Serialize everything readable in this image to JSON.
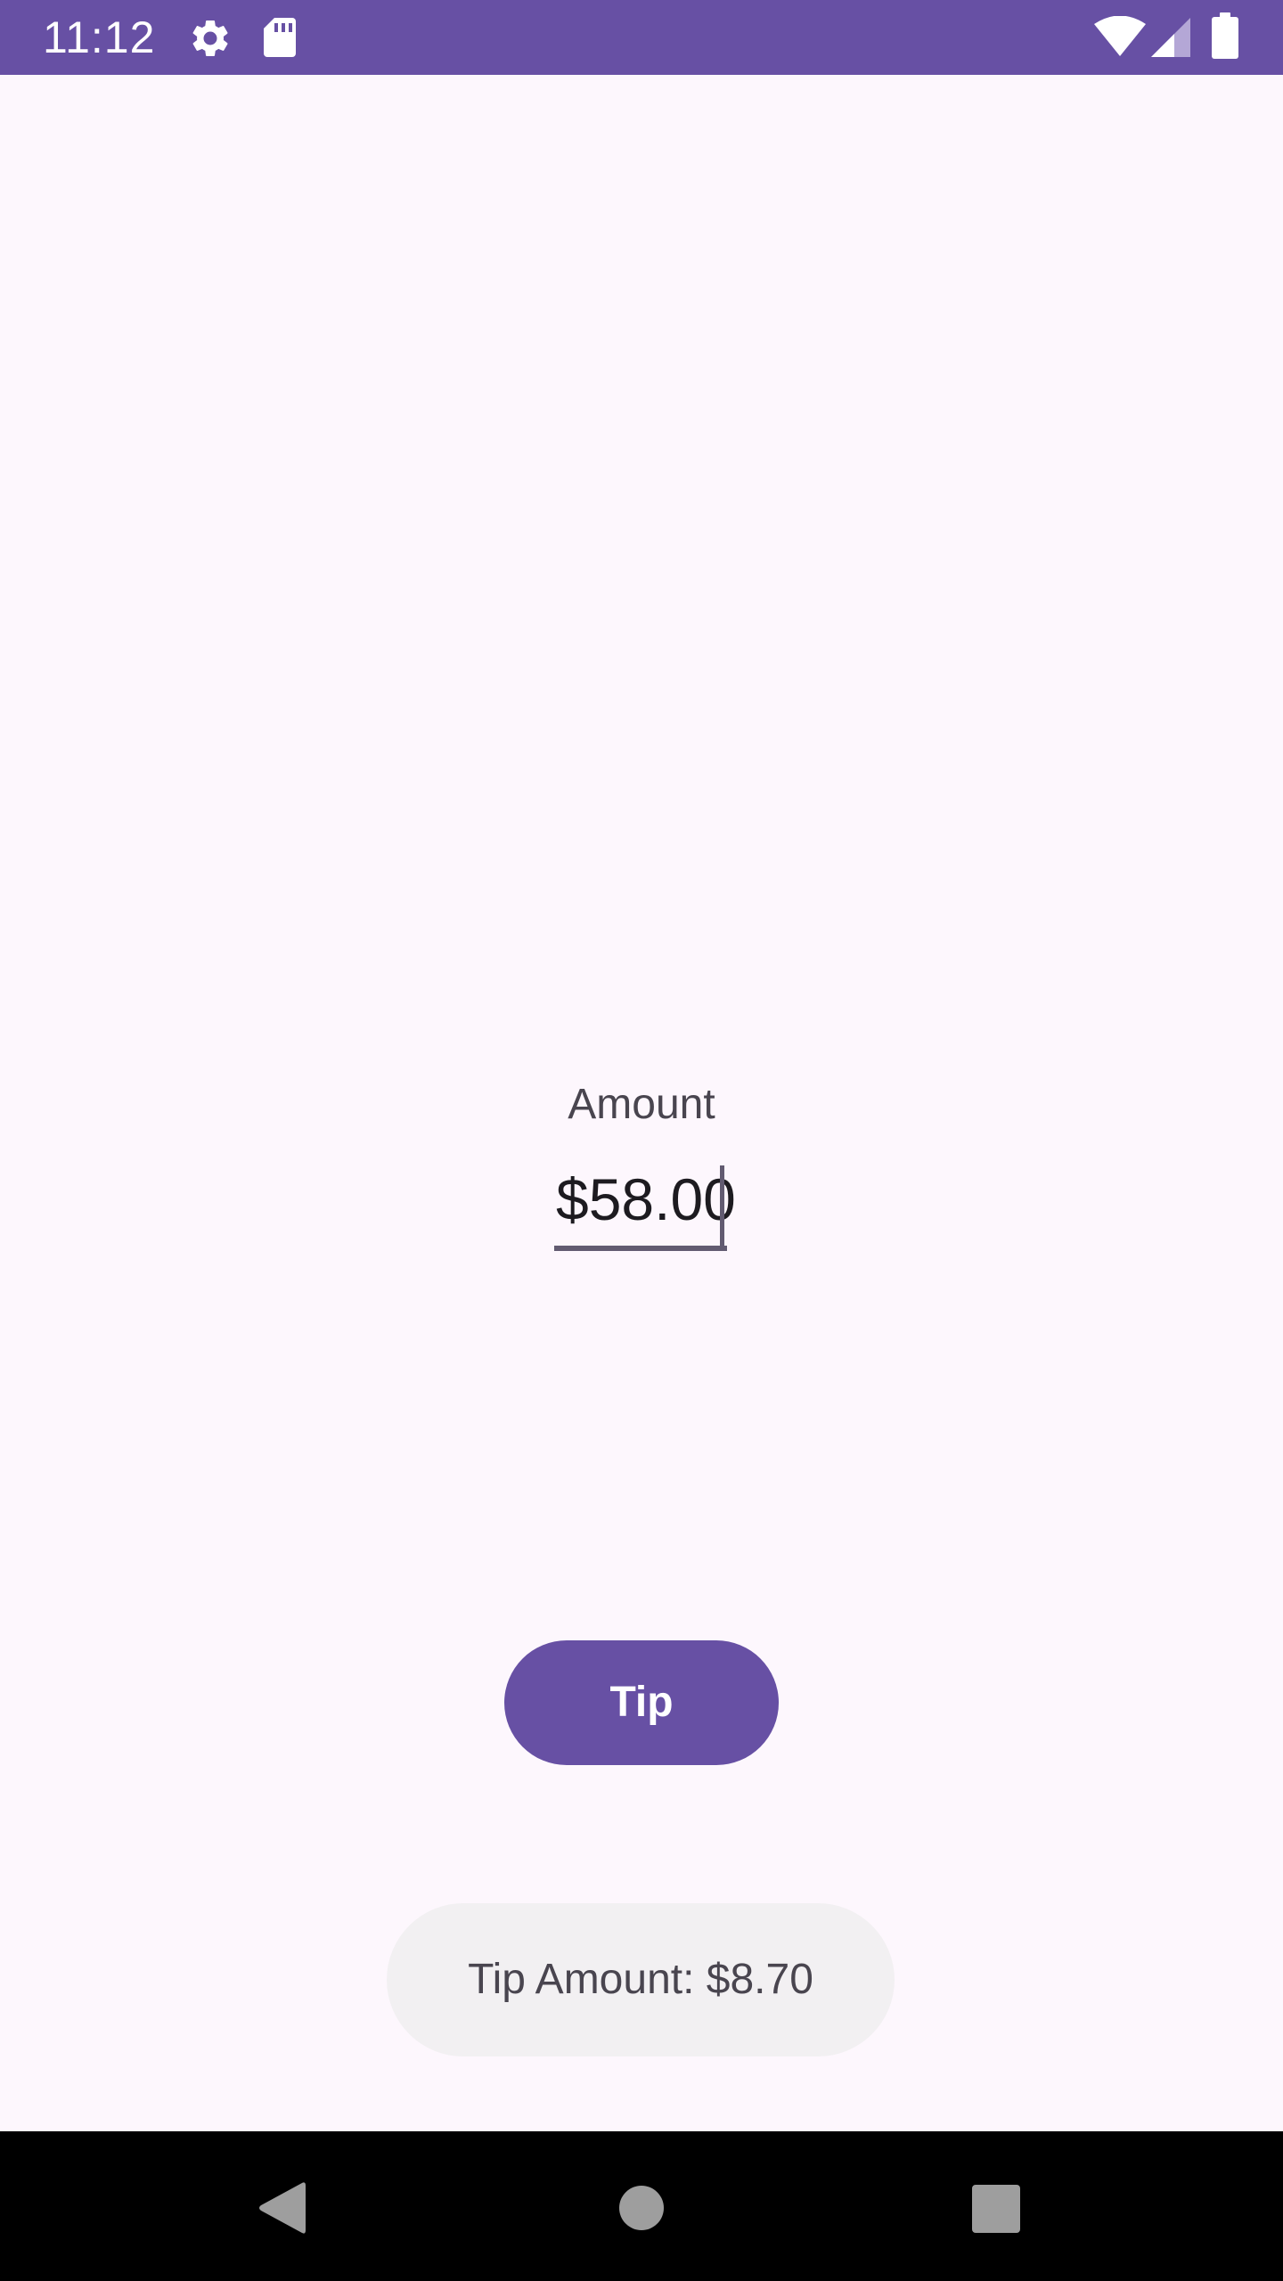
{
  "status_bar": {
    "time": "11:12",
    "background": "#6750A4",
    "left_icons": [
      "gear-icon",
      "sd-card-icon"
    ],
    "right_icons": [
      "wifi-icon",
      "cell-signal-icon",
      "battery-icon"
    ]
  },
  "main": {
    "amount_label": "Amount",
    "amount_value": "$58.00",
    "tip_button_label": "Tip",
    "tip_result": "Tip Amount: $8.70"
  },
  "colors": {
    "accent": "#6750A4",
    "background": "#FDF7FD",
    "result_background": "#F2F0F2",
    "navigation_bar": "#000000"
  },
  "nav_bar": {
    "buttons": [
      "back-icon",
      "home-icon",
      "recents-icon"
    ]
  }
}
